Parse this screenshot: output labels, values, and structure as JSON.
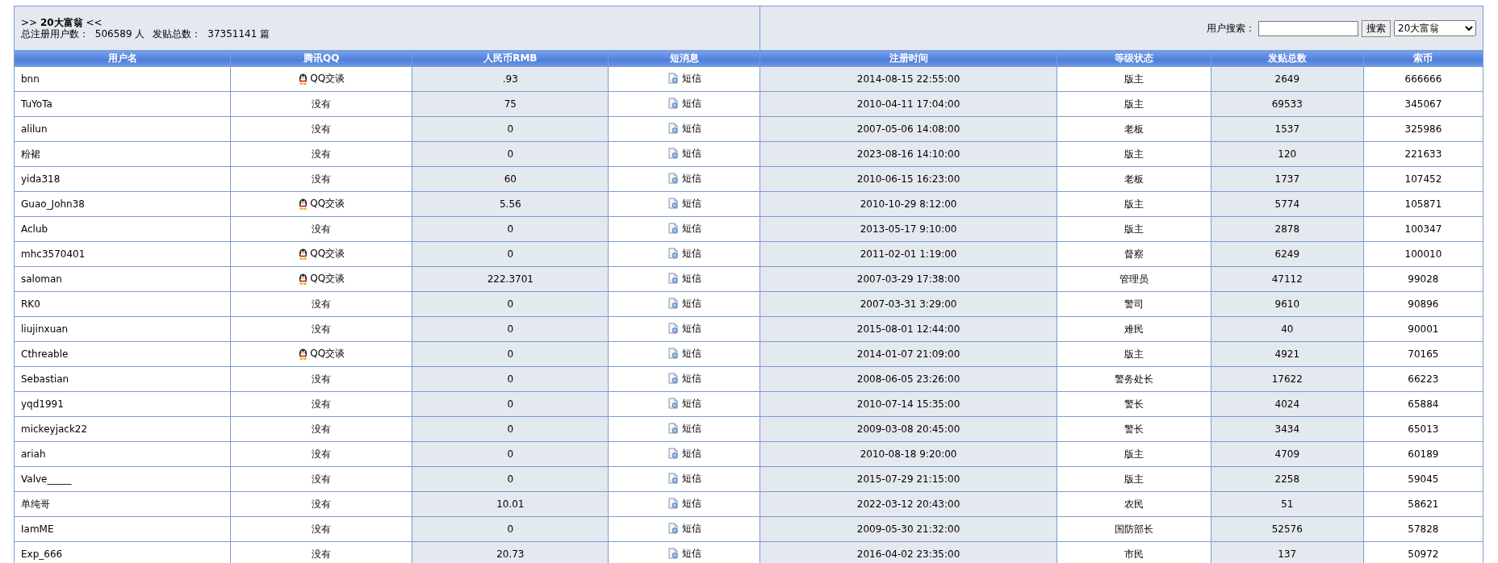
{
  "header": {
    "title_prefix": ">>",
    "title": "20大富翁",
    "title_suffix": "<<",
    "stats": [
      {
        "label": "总注册用户数：",
        "value": "506589 人"
      },
      {
        "label": "发贴总数：",
        "value": "37351141 篇"
      }
    ]
  },
  "search": {
    "label": "用户搜索：",
    "button": "搜索",
    "select_value": "20大富翁"
  },
  "table": {
    "columns": [
      "用户名",
      "腾讯QQ",
      "人民币RMB",
      "短消息",
      "注册时间",
      "等级状态",
      "发贴总数",
      "索币"
    ],
    "rows": [
      {
        "user": "bnn",
        "qq": {
          "kind": "chat",
          "text": "QQ交谈"
        },
        "rmb": ".93",
        "message": "短信",
        "registered": "2014-08-15 22:55:00",
        "rank": "版主",
        "posts": "2649",
        "coins": "666666"
      },
      {
        "user": "TuYoTa",
        "qq": {
          "kind": "none",
          "text": "没有"
        },
        "rmb": "75",
        "message": "短信",
        "registered": "2010-04-11 17:04:00",
        "rank": "版主",
        "posts": "69533",
        "coins": "345067"
      },
      {
        "user": "alilun",
        "qq": {
          "kind": "none",
          "text": "没有"
        },
        "rmb": "0",
        "message": "短信",
        "registered": "2007-05-06 14:08:00",
        "rank": "老板",
        "posts": "1537",
        "coins": "325986"
      },
      {
        "user": "粉裙",
        "qq": {
          "kind": "none",
          "text": "没有"
        },
        "rmb": "0",
        "message": "短信",
        "registered": "2023-08-16 14:10:00",
        "rank": "版主",
        "posts": "120",
        "coins": "221633"
      },
      {
        "user": "yida318",
        "qq": {
          "kind": "none",
          "text": "没有"
        },
        "rmb": "60",
        "message": "短信",
        "registered": "2010-06-15 16:23:00",
        "rank": "老板",
        "posts": "1737",
        "coins": "107452"
      },
      {
        "user": "Guao_John38",
        "qq": {
          "kind": "chat",
          "text": "QQ交谈"
        },
        "rmb": "5.56",
        "message": "短信",
        "registered": "2010-10-29 8:12:00",
        "rank": "版主",
        "posts": "5774",
        "coins": "105871"
      },
      {
        "user": "Aclub",
        "qq": {
          "kind": "none",
          "text": "没有"
        },
        "rmb": "0",
        "message": "短信",
        "registered": "2013-05-17 9:10:00",
        "rank": "版主",
        "posts": "2878",
        "coins": "100347"
      },
      {
        "user": "mhc3570401",
        "qq": {
          "kind": "chat",
          "text": "QQ交谈"
        },
        "rmb": "0",
        "message": "短信",
        "registered": "2011-02-01 1:19:00",
        "rank": "督察",
        "posts": "6249",
        "coins": "100010"
      },
      {
        "user": "saloman",
        "qq": {
          "kind": "chat",
          "text": "QQ交谈"
        },
        "rmb": "222.3701",
        "message": "短信",
        "registered": "2007-03-29 17:38:00",
        "rank": "管理员",
        "posts": "47112",
        "coins": "99028"
      },
      {
        "user": "RK0",
        "qq": {
          "kind": "none",
          "text": "没有"
        },
        "rmb": "0",
        "message": "短信",
        "registered": "2007-03-31 3:29:00",
        "rank": "警司",
        "posts": "9610",
        "coins": "90896"
      },
      {
        "user": "liujinxuan",
        "qq": {
          "kind": "none",
          "text": "没有"
        },
        "rmb": "0",
        "message": "短信",
        "registered": "2015-08-01 12:44:00",
        "rank": "难民",
        "posts": "40",
        "coins": "90001"
      },
      {
        "user": "Cthreable",
        "qq": {
          "kind": "chat",
          "text": "QQ交谈"
        },
        "rmb": "0",
        "message": "短信",
        "registered": "2014-01-07 21:09:00",
        "rank": "版主",
        "posts": "4921",
        "coins": "70165"
      },
      {
        "user": "Sebastian",
        "qq": {
          "kind": "none",
          "text": "没有"
        },
        "rmb": "0",
        "message": "短信",
        "registered": "2008-06-05 23:26:00",
        "rank": "警务处长",
        "posts": "17622",
        "coins": "66223"
      },
      {
        "user": "yqd1991",
        "qq": {
          "kind": "none",
          "text": "没有"
        },
        "rmb": "0",
        "message": "短信",
        "registered": "2010-07-14 15:35:00",
        "rank": "警长",
        "posts": "4024",
        "coins": "65884"
      },
      {
        "user": "mickeyjack22",
        "qq": {
          "kind": "none",
          "text": "没有"
        },
        "rmb": "0",
        "message": "短信",
        "registered": "2009-03-08 20:45:00",
        "rank": "警长",
        "posts": "3434",
        "coins": "65013"
      },
      {
        "user": "ariah",
        "qq": {
          "kind": "none",
          "text": "没有"
        },
        "rmb": "0",
        "message": "短信",
        "registered": "2010-08-18 9:20:00",
        "rank": "版主",
        "posts": "4709",
        "coins": "60189"
      },
      {
        "user": "Valve_____",
        "qq": {
          "kind": "none",
          "text": "没有"
        },
        "rmb": "0",
        "message": "短信",
        "registered": "2015-07-29 21:15:00",
        "rank": "版主",
        "posts": "2258",
        "coins": "59045"
      },
      {
        "user": "单纯哥",
        "qq": {
          "kind": "none",
          "text": "没有"
        },
        "rmb": "10.01",
        "message": "短信",
        "registered": "2022-03-12 20:43:00",
        "rank": "农民",
        "posts": "51",
        "coins": "58621"
      },
      {
        "user": "IamME",
        "qq": {
          "kind": "none",
          "text": "没有"
        },
        "rmb": "0",
        "message": "短信",
        "registered": "2009-05-30 21:32:00",
        "rank": "国防部长",
        "posts": "52576",
        "coins": "57828"
      },
      {
        "user": "Exp_666",
        "qq": {
          "kind": "none",
          "text": "没有"
        },
        "rmb": "20.73",
        "message": "短信",
        "registered": "2016-04-02 23:35:00",
        "rank": "市民",
        "posts": "137",
        "coins": "50972"
      }
    ]
  }
}
